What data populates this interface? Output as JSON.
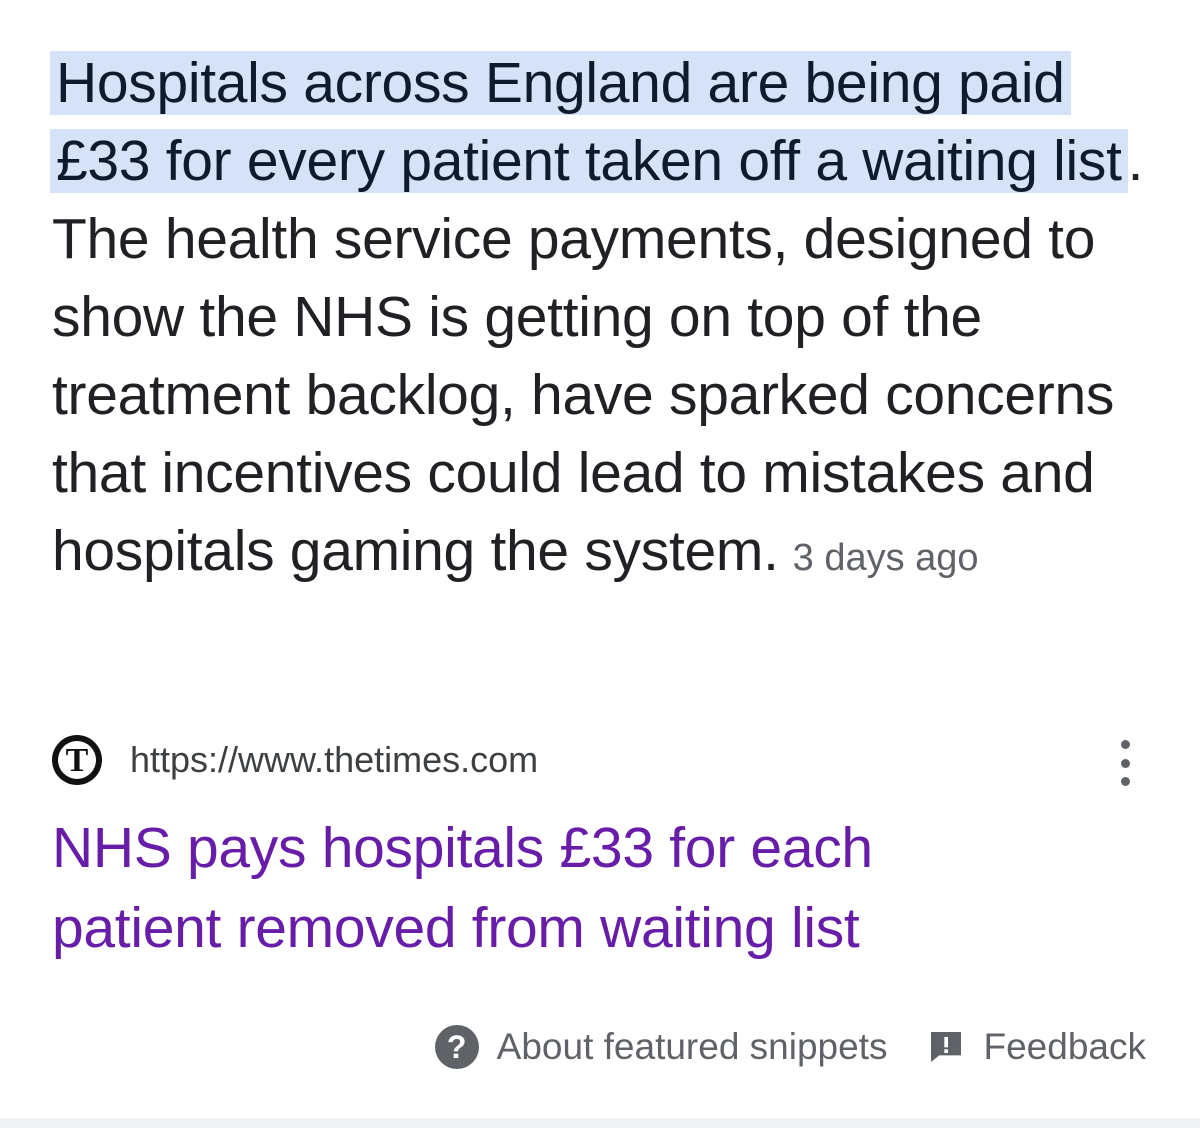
{
  "snippet": {
    "highlighted_text": "Hospitals across England are being paid £33 for every patient taken off a waiting list",
    "body_text": ". The health service payments, designed to show the NHS is getting on top of the treatment backlog, have sparked concerns that incentives could lead to mistakes and hospitals gaming the system.",
    "date": "3 days ago"
  },
  "source": {
    "favicon_letter": "T",
    "url": "https://www.thetimes.com",
    "favicon_icon": "the-times-logo-icon",
    "menu_icon": "more-vert-icon"
  },
  "result": {
    "title": "NHS pays hospitals £33 for each patient removed from waiting list",
    "link_color": "#681da8"
  },
  "footer": {
    "about_label": "About featured snippets",
    "about_icon": "help-icon",
    "feedback_label": "Feedback",
    "feedback_icon": "feedback-icon"
  },
  "colors": {
    "highlight_bg": "#d6e2f7",
    "text": "#202124",
    "secondary_text": "#5f6368"
  }
}
